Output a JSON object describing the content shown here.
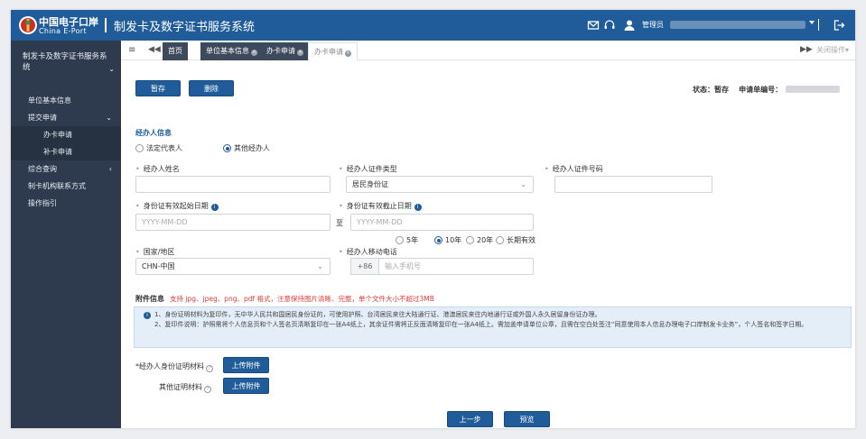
{
  "header": {
    "logo_cn": "中国电子口岸",
    "logo_en": "China E-Port",
    "title": "制发卡及数字证书服务系统",
    "admin_label": "管理员",
    "icons": [
      "mail-icon",
      "headset-icon",
      "user-icon",
      "logout-icon"
    ]
  },
  "sidebar": {
    "group_title": "制发卡及数字证书服务系统",
    "items": [
      {
        "label": "单位基本信息"
      },
      {
        "label": "提交申请"
      },
      {
        "label": "办卡申请"
      },
      {
        "label": "补卡申请"
      },
      {
        "label": "综合查询"
      },
      {
        "label": "制卡机构联系方式"
      },
      {
        "label": "操作指引"
      }
    ]
  },
  "tabs": {
    "items": [
      {
        "label": "首页"
      },
      {
        "label": "单位基本信息"
      },
      {
        "label": "办卡申请"
      },
      {
        "label": "办卡申请"
      }
    ],
    "close_ops": "关闭操作"
  },
  "toolbar": {
    "save_label": "暂存",
    "delete_label": "删除",
    "status_label": "状态：",
    "status_value": "暂存",
    "apply_no_label": "申请单编号："
  },
  "agent": {
    "section_title": "经办人信息",
    "type_options": [
      "法定代表人",
      "其他经办人"
    ],
    "name_label": "经办人姓名",
    "id_type_label": "经办人证件类型",
    "id_type_value": "居民身份证",
    "id_no_label": "经办人证件号码",
    "valid_start_label": "身份证有效起始日期",
    "valid_end_label": "身份证有效截止日期",
    "date_placeholder": "YYYY-MM-DD",
    "to_label": "至",
    "period_options": [
      "5年",
      "10年",
      "20年",
      "长期有效"
    ],
    "country_label": "国家/地区",
    "country_value": "CHN-中国",
    "phone_label": "经办人移动电话",
    "phone_prefix": "+86",
    "phone_placeholder": "输入手机号"
  },
  "attachments": {
    "title": "附件信息",
    "hint": "支持 jpg、jpeg、png、pdf 格式，注意保持图片清晰、完整，单个文件大小不超过3MB",
    "notice_1": "1、身份证明材料为复印件，无中华人民共和国居民身份证的，可使用护照、台湾居民来往大陆通行证、港澳居民来往内地通行证或外国人永久居留身份证办理。",
    "notice_2": "2、复印件说明：护照需将个人信息页和个人签名页清晰复印在一张A4纸上，其余证件需将正反面清晰复印在一张A4纸上。需加盖申请单位公章，且需在空白处签注“同意使用本人信息办理电子口岸制发卡业务”，个人签名和签字日期。",
    "id_material_label": "*经办人身份证明材料",
    "other_material_label": "其他证明材料",
    "upload_label": "上传附件"
  },
  "footer": {
    "prev_label": "上一步",
    "preview_label": "预览"
  }
}
